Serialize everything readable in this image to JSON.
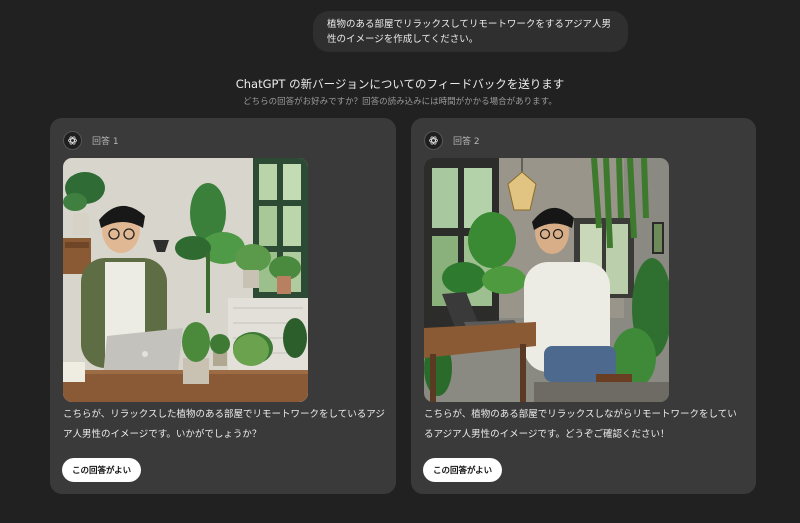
{
  "user_message": "植物のある部屋でリラックスしてリモートワークをするアジア人男性のイメージを作成してください。",
  "feedback": {
    "title": "ChatGPT の新バージョンについてのフィードバックを送ります",
    "subtitle": "どちらの回答がお好みですか？回答の読み込みには時間がかかる場合があります。"
  },
  "responses": [
    {
      "label": "回答 1",
      "text": "こちらが、リラックスした植物のある部屋でリモートワークをしているアジア人男性のイメージです。いかがでしょうか？",
      "button": "この回答がよい"
    },
    {
      "label": "回答 2",
      "text": "こちらが、植物のある部屋でリラックスしながらリモートワークをしているアジア人男性のイメージです。どうぞご確認ください！",
      "button": "この回答がよい"
    }
  ],
  "colors": {
    "background": "#212121",
    "card": "#3a3a3a",
    "bubble": "#2f2f2f",
    "button": "#ffffff"
  },
  "icons": {
    "avatar": "openai-logo-icon"
  }
}
